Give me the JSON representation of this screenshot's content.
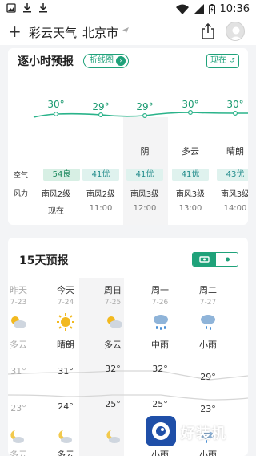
{
  "status_bar": {
    "time": "10:36",
    "icons": [
      "image-icon",
      "download-icon",
      "download-icon",
      "wifi-icon",
      "signal-icon",
      "battery-icon"
    ]
  },
  "header": {
    "add_label": "+",
    "app_name": "彩云天气",
    "city": "北京市",
    "icons": [
      "location-arrow-icon",
      "share-icon",
      "avatar-icon"
    ]
  },
  "hourly": {
    "title": "逐小时预报",
    "chart_toggle_label": "折线图",
    "now_button_label": "现在",
    "air_label": "空气",
    "wind_label": "风力",
    "hours": [
      {
        "temp": "30°",
        "weather": "",
        "aqi": "54良",
        "wind": "南风2级",
        "time": "现在"
      },
      {
        "temp": "29°",
        "weather": "",
        "aqi": "41优",
        "wind": "南风2级",
        "time": "11:00"
      },
      {
        "temp": "29°",
        "weather": "阴",
        "aqi": "41优",
        "wind": "南风3级",
        "time": "12:00"
      },
      {
        "temp": "30°",
        "weather": "多云",
        "aqi": "41优",
        "wind": "南风3级",
        "time": "13:00"
      },
      {
        "temp": "30°",
        "weather": "晴朗",
        "aqi": "43优",
        "wind": "南风3级",
        "time": "14:00"
      }
    ],
    "colors": {
      "accent": "#1fa27a",
      "line": "#2ab38a"
    }
  },
  "daily": {
    "title": "15天预报",
    "days": [
      {
        "name": "昨天",
        "date": "7-23",
        "icon": "partly-cloudy-icon",
        "weather": "多云",
        "high": "31°",
        "low": "23°",
        "past": true
      },
      {
        "name": "今天",
        "date": "7-24",
        "icon": "sunny-icon",
        "weather": "晴朗",
        "high": "31°",
        "low": "24°",
        "past": false
      },
      {
        "name": "周日",
        "date": "7-25",
        "icon": "partly-cloudy-icon",
        "weather": "多云",
        "high": "32°",
        "low": "25°",
        "past": false
      },
      {
        "name": "周一",
        "date": "7-26",
        "icon": "rain-icon",
        "weather": "中雨",
        "high": "32°",
        "low": "25°",
        "past": false
      },
      {
        "name": "周二",
        "date": "7-27",
        "icon": "rain-icon",
        "weather": "小雨",
        "high": "29°",
        "low": "23°",
        "past": false
      }
    ],
    "next_row_weather": [
      "多云",
      "多云",
      "小雨",
      "小雨"
    ]
  },
  "watermark": {
    "text": "好装机"
  }
}
